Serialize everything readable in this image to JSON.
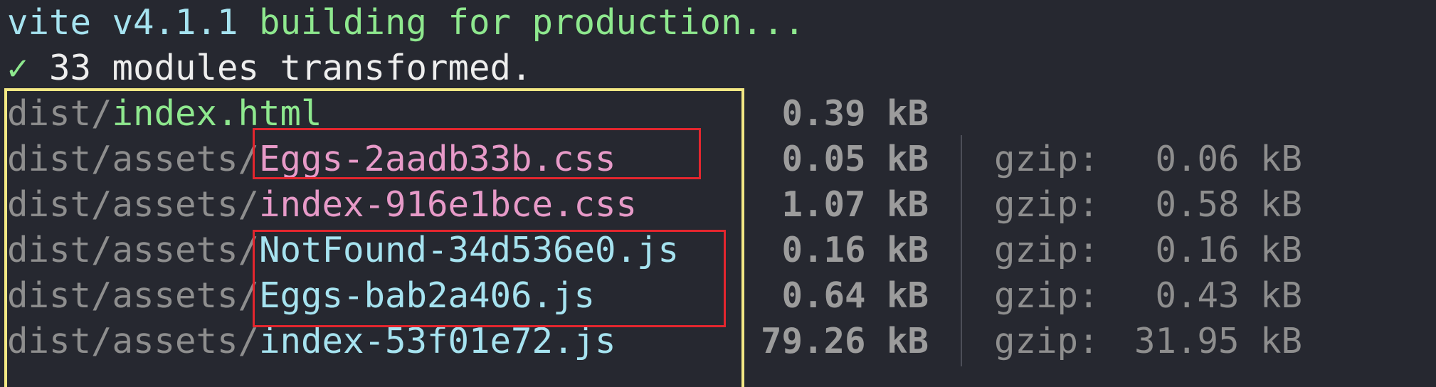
{
  "header": {
    "vite": "vite v4.1.1",
    "building": "building for production..."
  },
  "status": {
    "check": "✓",
    "text": "33 modules transformed."
  },
  "files": [
    {
      "dir": "dist/",
      "name": "index.html",
      "color": "#8ee88e",
      "size": "0.39 kB",
      "gzip_label": "",
      "gzip_size": ""
    },
    {
      "dir": "dist/assets/",
      "name": "Eggs-2aadb33b.css",
      "color": "#e79ac8",
      "size": "0.05 kB",
      "gzip_label": "gzip:",
      "gzip_size": "0.06 kB"
    },
    {
      "dir": "dist/assets/",
      "name": "index-916e1bce.css",
      "color": "#e79ac8",
      "size": "1.07 kB",
      "gzip_label": "gzip:",
      "gzip_size": "0.58 kB"
    },
    {
      "dir": "dist/assets/",
      "name": "NotFound-34d536e0.js",
      "color": "#a6e3f0",
      "size": "0.16 kB",
      "gzip_label": "gzip:",
      "gzip_size": "0.16 kB"
    },
    {
      "dir": "dist/assets/",
      "name": "Eggs-bab2a406.js",
      "color": "#a6e3f0",
      "size": "0.64 kB",
      "gzip_label": "gzip:",
      "gzip_size": "0.43 kB"
    },
    {
      "dir": "dist/assets/",
      "name": "index-53f01e72.js",
      "color": "#a6e3f0",
      "size": "79.26 kB",
      "gzip_label": "gzip:",
      "gzip_size": "31.95 kB"
    }
  ],
  "colors": {
    "background": "#262830",
    "highlight_yellow": "#f3e884",
    "highlight_red": "#e3262e"
  }
}
